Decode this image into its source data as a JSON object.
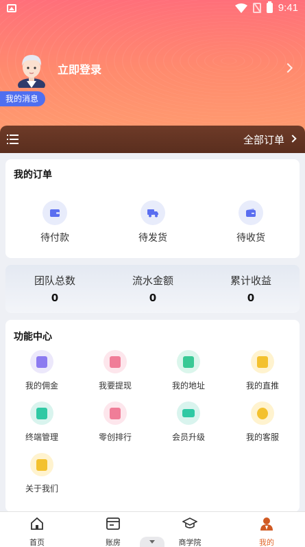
{
  "status_bar": {
    "time": "9:41"
  },
  "profile": {
    "login_text": "立即登录",
    "message_badge": "我的消息"
  },
  "order_bar": {
    "all_orders": "全部订单"
  },
  "my_orders": {
    "title": "我的订单",
    "items": [
      {
        "label": "待付款",
        "icon": "wallet-icon"
      },
      {
        "label": "待发货",
        "icon": "truck-icon"
      },
      {
        "label": "待收货",
        "icon": "box-icon"
      }
    ]
  },
  "stats": [
    {
      "label": "团队总数",
      "value": "0"
    },
    {
      "label": "流水金额",
      "value": "0"
    },
    {
      "label": "累计收益",
      "value": "0"
    }
  ],
  "functions": {
    "title": "功能中心",
    "items": [
      {
        "label": "我的佣金",
        "icon": "commission-icon",
        "color": "purple"
      },
      {
        "label": "我要提现",
        "icon": "withdraw-icon",
        "color": "pink"
      },
      {
        "label": "我的地址",
        "icon": "address-icon",
        "color": "green"
      },
      {
        "label": "我的直推",
        "icon": "referral-icon",
        "color": "yellow"
      },
      {
        "label": "终端管理",
        "icon": "terminal-icon",
        "color": "teal"
      },
      {
        "label": "零创排行",
        "icon": "ranking-icon",
        "color": "pink"
      },
      {
        "label": "会员升级",
        "icon": "card-icon",
        "color": "teal"
      },
      {
        "label": "我的客服",
        "icon": "service-icon",
        "color": "yellow"
      },
      {
        "label": "关于我们",
        "icon": "about-icon",
        "color": "yellow"
      }
    ]
  },
  "tabs": [
    {
      "label": "首页",
      "icon": "home-icon"
    },
    {
      "label": "账房",
      "icon": "ledger-icon"
    },
    {
      "label": "商学院",
      "icon": "graduation-cap-icon"
    },
    {
      "label": "我的",
      "icon": "user-icon",
      "active": true
    }
  ],
  "colors": {
    "accent": "#e0662c",
    "badge": "#4f6ff0",
    "order_bar": "#5e301f"
  }
}
